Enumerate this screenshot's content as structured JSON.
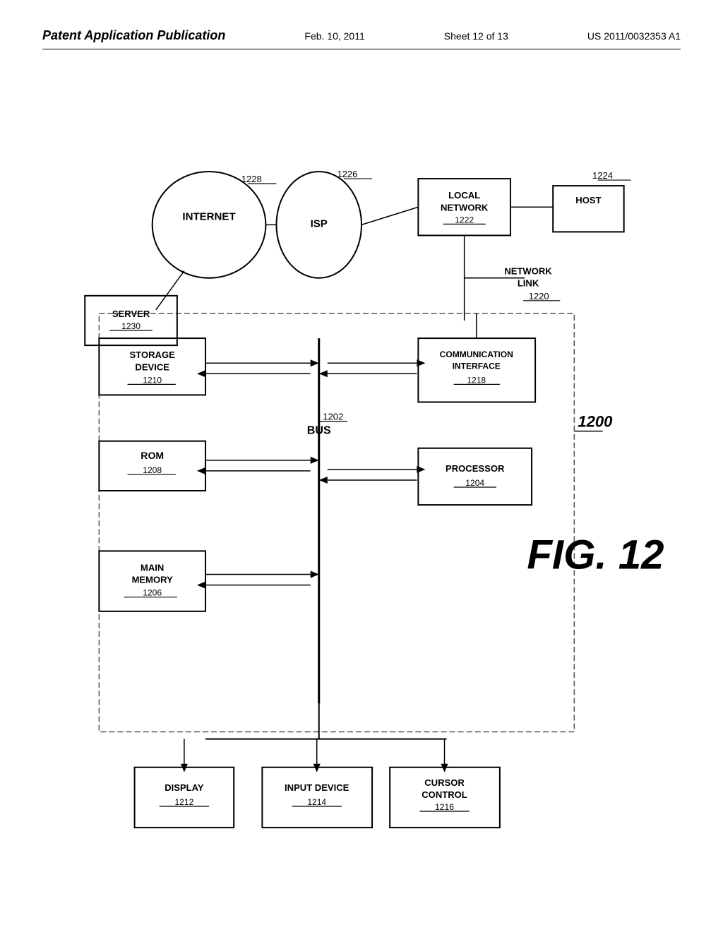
{
  "header": {
    "title": "Patent Application Publication",
    "date": "Feb. 10, 2011",
    "sheet": "Sheet 12 of 13",
    "patent": "US 2011/0032353 A1"
  },
  "figure": {
    "label": "FIG. 12",
    "number": "1200",
    "nodes": {
      "internet": {
        "label": "INTERNET",
        "id": "1228"
      },
      "isp": {
        "label": "ISP",
        "id": "1226"
      },
      "local_network": {
        "label": "LOCAL\nNETWORK",
        "id": "1222"
      },
      "host": {
        "label": "HOST",
        "id": "1224"
      },
      "network_link": {
        "label": "NETWORK\nLINK",
        "id": "1220"
      },
      "server": {
        "label": "SERVER",
        "id": "1230"
      },
      "storage": {
        "label": "STORAGE\nDEVICE",
        "id": "1210"
      },
      "bus": {
        "label": "BUS",
        "id": "1202"
      },
      "comm_interface": {
        "label": "COMMUNICATION\nINTERFACE",
        "id": "1218"
      },
      "rom": {
        "label": "ROM",
        "id": "1208"
      },
      "processor": {
        "label": "PROCESSOR",
        "id": "1204"
      },
      "main_memory": {
        "label": "MAIN\nMEMORY",
        "id": "1206"
      },
      "display": {
        "label": "DISPLAY",
        "id": "1212"
      },
      "input_device": {
        "label": "INPUT DEVICE",
        "id": "1214"
      },
      "cursor_control": {
        "label": "CURSOR\nCONTROL",
        "id": "1216"
      }
    }
  }
}
